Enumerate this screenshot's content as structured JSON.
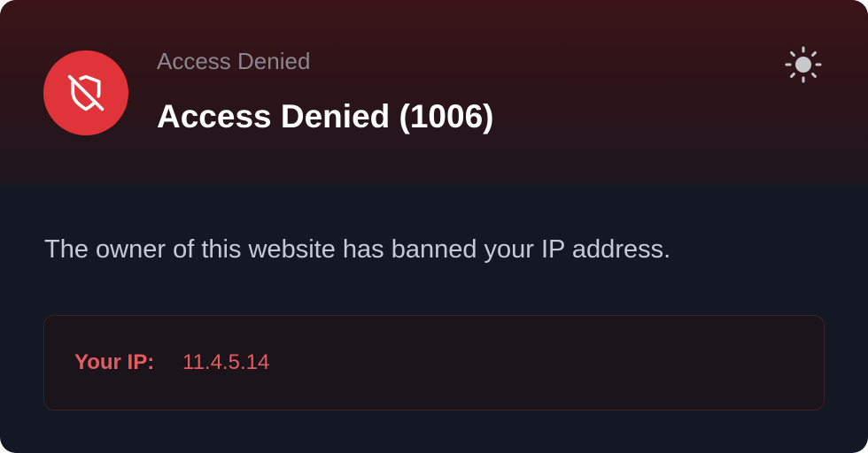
{
  "header": {
    "eyebrow": "Access Denied",
    "title": "Access Denied (1006)",
    "badge_icon": "shield-off-icon",
    "theme_icon": "sun-icon"
  },
  "body": {
    "message": "The owner of this website has banned your IP address."
  },
  "ip_panel": {
    "label": "Your IP:",
    "value": "11.4.5.14"
  },
  "colors": {
    "accent": "#e0333a",
    "ip_text": "#e35d60",
    "background": "#131824"
  }
}
